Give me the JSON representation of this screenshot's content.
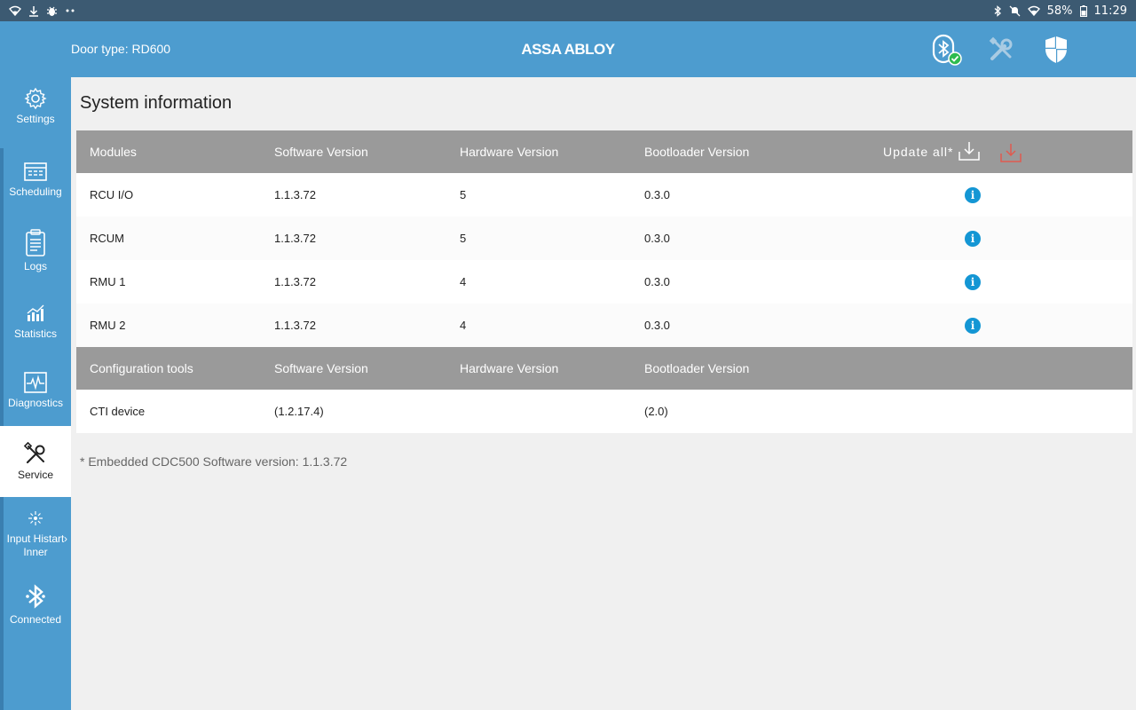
{
  "status_bar": {
    "battery": "58%",
    "time": "11:29"
  },
  "header": {
    "door_type": "Door type: RD600",
    "brand": "ASSA ABLOY",
    "icons": [
      "bluetooth-connected-icon",
      "tools-icon",
      "shield-icon"
    ]
  },
  "sidebar": {
    "items": [
      {
        "label": "Settings",
        "icon": "gear-icon"
      },
      {
        "label": "Scheduling",
        "icon": "calendar-icon"
      },
      {
        "label": "Logs",
        "icon": "clipboard-icon"
      },
      {
        "label": "Statistics",
        "icon": "bar-chart-icon"
      },
      {
        "label": "Diagnostics",
        "icon": "pulse-icon"
      },
      {
        "label": "Service",
        "icon": "tools-icon",
        "active": true
      },
      {
        "label": "Input Histart Inner",
        "icon": "sparkle-icon"
      },
      {
        "label": "Connected",
        "icon": "bluetooth-icon"
      }
    ]
  },
  "main": {
    "title": "System information",
    "modules_header": {
      "col1": "Modules",
      "col2": "Software Version",
      "col3": "Hardware Version",
      "col4": "Bootloader Version",
      "update_all": "Update all*"
    },
    "modules": [
      {
        "name": "RCU I/O",
        "software": "1.1.3.72",
        "hardware": "5",
        "bootloader": "0.3.0"
      },
      {
        "name": "RCUM",
        "software": "1.1.3.72",
        "hardware": "5",
        "bootloader": "0.3.0"
      },
      {
        "name": "RMU 1",
        "software": "1.1.3.72",
        "hardware": "4",
        "bootloader": "0.3.0"
      },
      {
        "name": "RMU 2",
        "software": "1.1.3.72",
        "hardware": "4",
        "bootloader": "0.3.0"
      }
    ],
    "tools_header": {
      "col1": "Configuration tools",
      "col2": "Software Version",
      "col3": "Hardware Version",
      "col4": "Bootloader Version"
    },
    "tools": [
      {
        "name": "CTI device",
        "software": "(1.2.17.4)",
        "hardware": "",
        "bootloader": "(2.0)"
      }
    ],
    "footnote": "* Embedded CDC500 Software version: 1.1.3.72"
  },
  "colors": {
    "primary": "#4d9ccf",
    "status_bar": "#3c5a72",
    "table_header": "#9a9a9a",
    "info": "#1496d4",
    "download_alert": "#e05a4f"
  }
}
